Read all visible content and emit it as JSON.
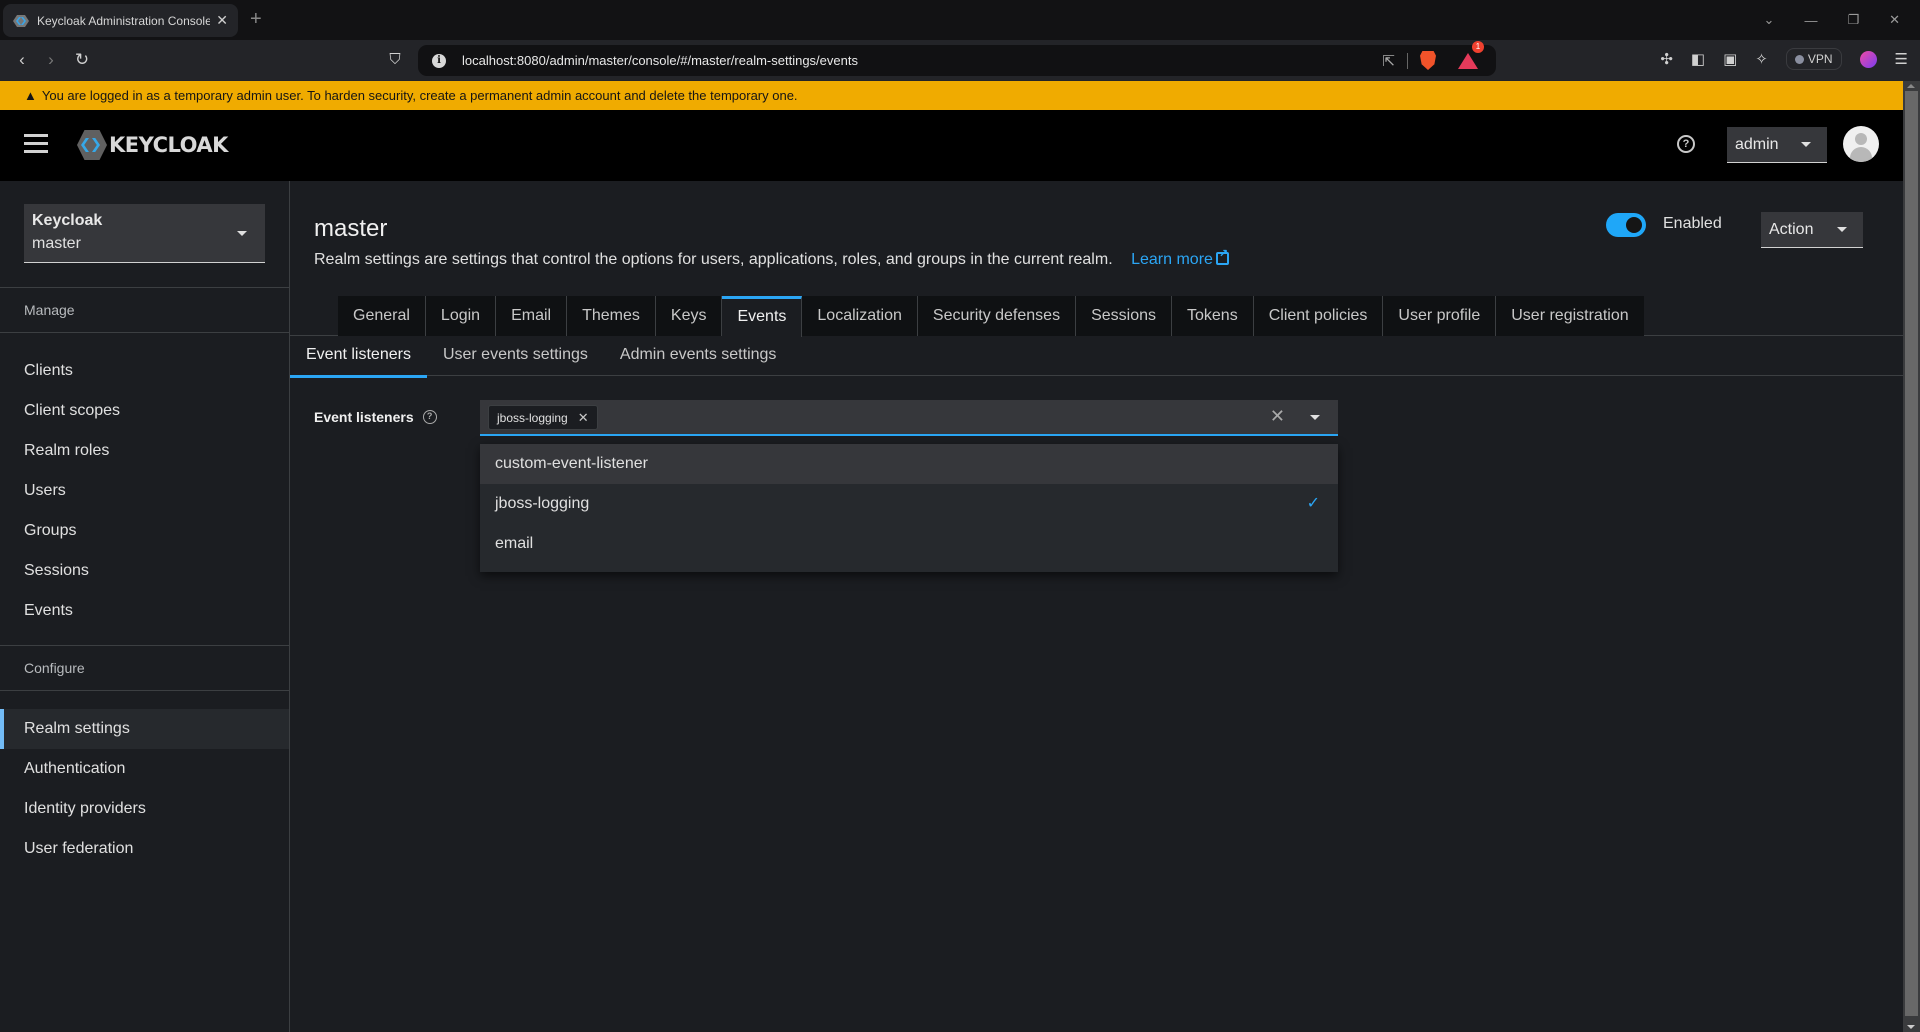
{
  "browser": {
    "tab_title": "Keycloak Administration Console",
    "new_tab_icon": "plus-icon",
    "url": "localhost:8080/admin/master/console/#/master/realm-settings/events",
    "brave_badge_count": "1",
    "vpn_label": "VPN"
  },
  "banner": {
    "icon": "warning-triangle-icon",
    "text": "You are logged in as a temporary admin user. To harden security, create a permanent admin account and delete the temporary one.",
    "color": "#f0ab00"
  },
  "masthead": {
    "logo_text": "KEYCLOAK",
    "user_label": "admin"
  },
  "sidebar": {
    "realm_selector": {
      "title": "Keycloak",
      "realm": "master"
    },
    "sections": [
      {
        "label": "Manage",
        "items": [
          "Clients",
          "Client scopes",
          "Realm roles",
          "Users",
          "Groups",
          "Sessions",
          "Events"
        ]
      },
      {
        "label": "Configure",
        "items": [
          "Realm settings",
          "Authentication",
          "Identity providers",
          "User federation"
        ]
      }
    ],
    "active_item": "Realm settings"
  },
  "page": {
    "title": "master",
    "description": "Realm settings are settings that control the options for users, applications, roles, and groups in the current realm.",
    "learn_more": "Learn more",
    "enabled_label": "Enabled",
    "enabled": true,
    "action_label": "Action",
    "tabs": [
      "General",
      "Login",
      "Email",
      "Themes",
      "Keys",
      "Events",
      "Localization",
      "Security defenses",
      "Sessions",
      "Tokens",
      "Client policies",
      "User profile",
      "User registration"
    ],
    "active_tab": "Events",
    "subtabs": [
      "Event listeners",
      "User events settings",
      "Admin events settings"
    ],
    "active_subtab": "Event listeners",
    "form": {
      "label": "Event listeners",
      "selected_chips": [
        "jboss-logging"
      ],
      "options": [
        {
          "label": "custom-event-listener",
          "selected": false
        },
        {
          "label": "jboss-logging",
          "selected": true
        },
        {
          "label": "email",
          "selected": false
        }
      ]
    }
  },
  "colors": {
    "accent": "#2ba6f5",
    "sidebar_active_border": "#73bcf7",
    "background": "#1b1d21",
    "masthead": "#000000"
  }
}
